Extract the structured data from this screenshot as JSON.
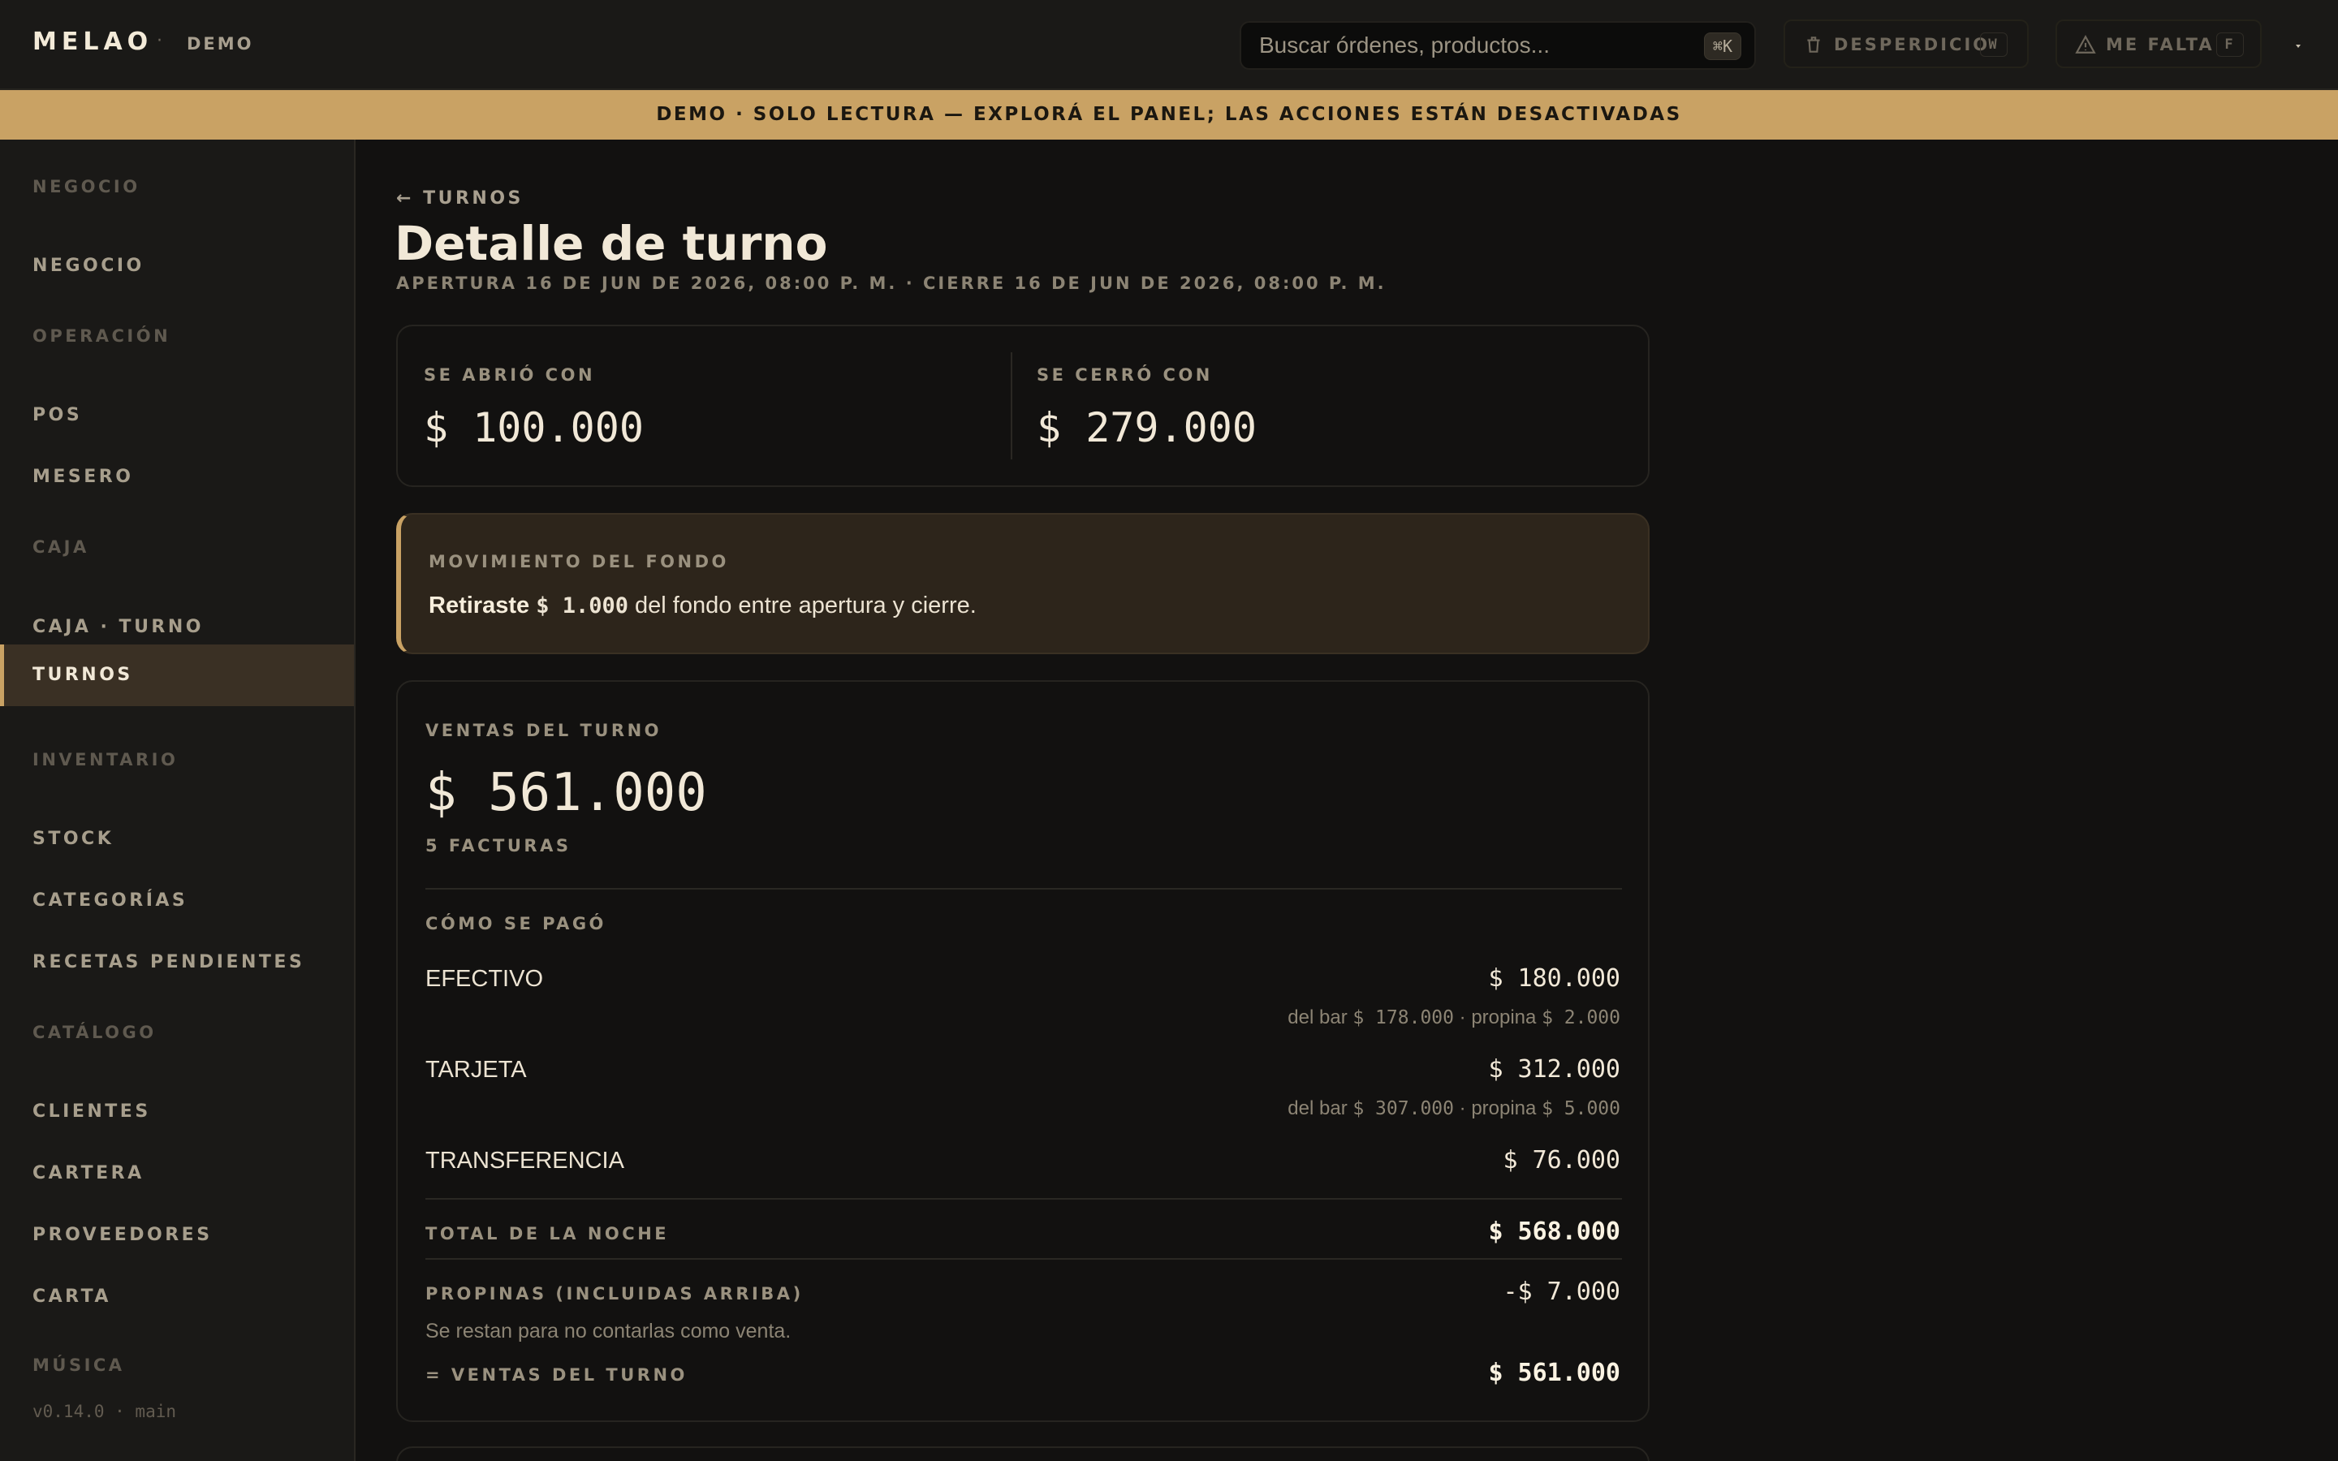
{
  "header": {
    "brand": "MELAO",
    "separator": "·",
    "mode": "DEMO",
    "search_placeholder": "Buscar órdenes, productos...",
    "search_shortcut": "⌘K",
    "waste_button": {
      "label": "DESPERDICIO",
      "key": "W",
      "icon": "trash-icon"
    },
    "missing_button": {
      "label": "ME FALTA",
      "key": "F",
      "icon": "warning-triangle-icon"
    },
    "user_menu_icon": "caret-down-icon"
  },
  "banner": "DEMO · SOLO LECTURA — EXPLORÁ EL PANEL; LAS ACCIONES ESTÁN DESACTIVADAS",
  "sidebar": {
    "sections": [
      {
        "title": "NEGOCIO",
        "items": [
          "NEGOCIO"
        ]
      },
      {
        "title": "OPERACIÓN",
        "items": [
          "POS",
          "MESERO"
        ]
      },
      {
        "title": "CAJA",
        "items": [
          "CAJA · TURNO",
          "TURNOS"
        ]
      },
      {
        "title": "INVENTARIO",
        "items": [
          "STOCK",
          "CATEGORÍAS",
          "RECETAS PENDIENTES"
        ]
      },
      {
        "title": "CATÁLOGO",
        "items": [
          "CLIENTES",
          "CARTERA",
          "PROVEEDORES",
          "CARTA"
        ]
      },
      {
        "title": "MÚSICA",
        "items": []
      }
    ],
    "active_item": "TURNOS",
    "version": "v0.14.0 · main"
  },
  "page": {
    "back_label": "← TURNOS",
    "title": "Detalle de turno",
    "subtitle": "APERTURA 16 DE JUN DE 2026, 08:00 P. M. · CIERRE 16 DE JUN DE 2026, 08:00 P. M."
  },
  "cash": {
    "opened_label": "SE ABRIÓ CON",
    "opened_value": "$ 100.000",
    "closed_label": "SE CERRÓ CON",
    "closed_value": "$ 279.000"
  },
  "fund_movement": {
    "label": "MOVIMIENTO DEL FONDO",
    "verb": "Retiraste",
    "amount": "$ 1.000",
    "rest": "del fondo entre apertura y cierre."
  },
  "sales": {
    "label": "VENTAS DEL TURNO",
    "total": "$ 561.000",
    "invoices": "5 FACTURAS",
    "payments_label": "CÓMO SE PAGÓ",
    "payments": [
      {
        "name": "EFECTIVO",
        "amount": "$ 180.000",
        "detail_prefix": "del bar",
        "bar": "$ 178.000",
        "detail_mid": "· propina",
        "tip": "$ 2.000"
      },
      {
        "name": "TARJETA",
        "amount": "$ 312.000",
        "detail_prefix": "del bar",
        "bar": "$ 307.000",
        "detail_mid": "· propina",
        "tip": "$ 5.000"
      },
      {
        "name": "TRANSFERENCIA",
        "amount": "$ 76.000"
      }
    ],
    "night_total_label": "TOTAL DE LA NOCHE",
    "night_total": "$ 568.000",
    "tips_label": "PROPINAS (INCLUIDAS ARRIBA)",
    "tips_value": "-$ 7.000",
    "tips_note": "Se restan para no contarlas como venta.",
    "net_label": "= VENTAS DEL TURNO",
    "net_value": "$ 561.000"
  }
}
